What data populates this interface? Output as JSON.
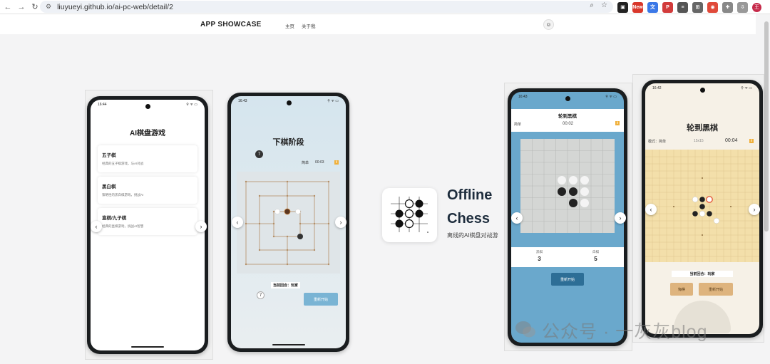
{
  "browser": {
    "url": "liuyueyi.github.io/ai-pc-web/detail/2",
    "profile_initial": "王",
    "ext_new_badge": "New"
  },
  "site": {
    "brand": "APP SHOWCASE",
    "nav": [
      "主页",
      "关于我"
    ]
  },
  "phone1": {
    "time": "16:44",
    "title": "AI棋盘游戏",
    "games": [
      {
        "title": "五子棋",
        "desc": "经典的五子棋游戏，与AI对战"
      },
      {
        "title": "黑白棋",
        "desc": "策略性的黑白棋游戏，挑战AI"
      },
      {
        "title": "直棋/九子棋",
        "desc": "经典的直棋游戏，挑战AI智慧"
      }
    ]
  },
  "phone2": {
    "time": "16:43",
    "title": "下棋阶段",
    "badge_top": "7",
    "badge_bottom": "7",
    "difficulty": "简单",
    "timer": "00:03",
    "turn": "当前回合：玩家",
    "restart": "重新开始"
  },
  "app": {
    "name": "Offline Chess",
    "subtitle": "离线的AI棋盘对战游"
  },
  "phone3": {
    "time": "16:43",
    "title": "轮到黑棋",
    "difficulty": "简单",
    "timer": "00:02",
    "black_label": "黑棋",
    "black_score": "3",
    "white_label": "白棋",
    "white_score": "5",
    "restart": "重新开始"
  },
  "phone4": {
    "time": "16:42",
    "title": "轮到黑棋",
    "mode": "模式：简单",
    "board_size": "15x15",
    "timer": "00:04",
    "turn": "当前回合：玩家",
    "undo": "悔棋",
    "restart": "重新开始"
  },
  "watermark": "公众号 · 一灰灰blog",
  "colors": {
    "phone3_bg": "#6aa8cc",
    "restart_blue": "#2d6e96",
    "wood": "#f3dfaa"
  }
}
